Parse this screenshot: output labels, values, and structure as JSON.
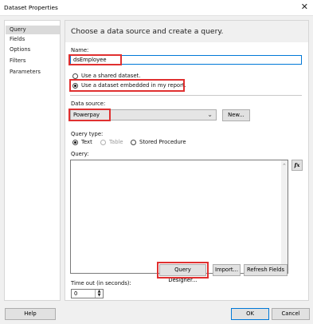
{
  "window": {
    "title": "Dataset Properties",
    "close_glyph": "✕"
  },
  "sidebar": {
    "items": [
      {
        "label": "Query"
      },
      {
        "label": "Fields"
      },
      {
        "label": "Options"
      },
      {
        "label": "Filters"
      },
      {
        "label": "Parameters"
      }
    ]
  },
  "main": {
    "header": "Choose a data source and create a query.",
    "name_label": "Name:",
    "name_value": "dsEmployee",
    "shared_option": "Use a shared dataset.",
    "embedded_option": "Use a dataset embedded in my report.",
    "datasource_label": "Data source:",
    "datasource_value": "Powerpay",
    "new_button": "New...",
    "query_type_label": "Query type:",
    "query_types": [
      "Text",
      "Table",
      "Stored Procedure"
    ],
    "query_label": "Query:",
    "query_text": "",
    "fx_label": "fx",
    "query_designer_button": "Query Designer...",
    "import_button": "Import...",
    "refresh_fields_button": "Refresh Fields",
    "timeout_label": "Time out (in seconds):",
    "timeout_value": "0"
  },
  "footer": {
    "help": "Help",
    "ok": "OK",
    "cancel": "Cancel"
  },
  "colors": {
    "highlight": "#e03030",
    "focus": "#0078d7"
  }
}
